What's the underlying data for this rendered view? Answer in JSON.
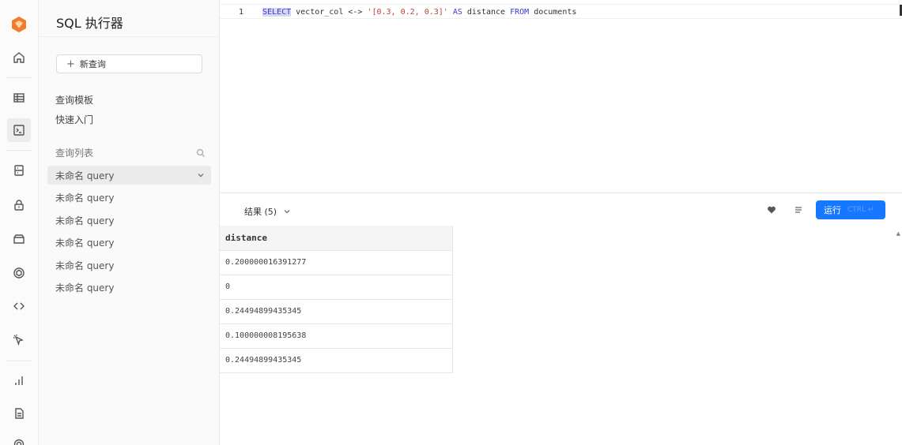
{
  "app": {
    "title": "SQL 执行器"
  },
  "rail": {
    "icons": [
      "home-icon",
      "table-icon",
      "terminal-icon",
      "database-icon",
      "lock-icon",
      "storage-icon",
      "module-icon",
      "code-icon",
      "pointer-icon",
      "chart-icon",
      "document-icon",
      "settings-icon"
    ],
    "active": "terminal-icon"
  },
  "sidebar": {
    "new_query": "新查询",
    "links": [
      "查询模板",
      "快速入门"
    ],
    "list_title": "查询列表",
    "queries": [
      "未命名 query",
      "未命名 query",
      "未命名 query",
      "未命名 query",
      "未命名 query",
      "未命名 query"
    ]
  },
  "editor": {
    "line_number": "1",
    "kw_select": "SELECT",
    "part1": " vector_col <-> ",
    "string": "'[0.3, 0.2, 0.3]'",
    "kw_as": " AS",
    "part2": " distance ",
    "kw_from": "FROM",
    "part3": " documents"
  },
  "results": {
    "label": "结果 (5)",
    "run_label": "运行",
    "run_shortcut": "CTRL ↵",
    "column": "distance",
    "rows": [
      "0.200000016391277",
      "0",
      "0.24494899435345",
      "0.100000008195638",
      "0.24494899435345"
    ]
  },
  "colors": {
    "accent": "#1677ff",
    "logo": "#f07b2a"
  }
}
